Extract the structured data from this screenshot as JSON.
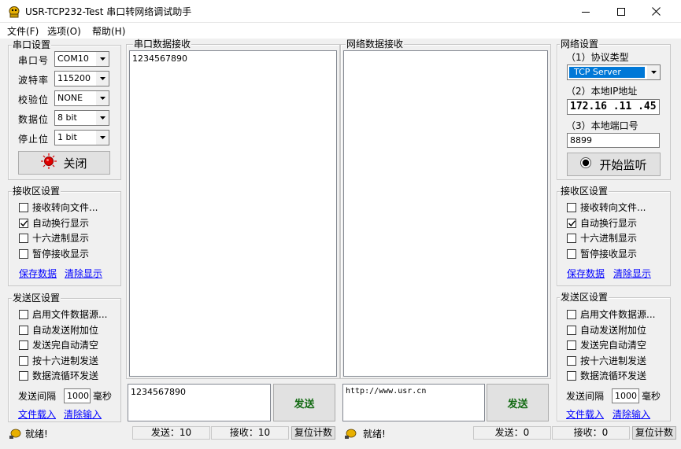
{
  "window": {
    "title": "USR-TCP232-Test 串口转网络调试助手"
  },
  "menu": [
    "文件(F)",
    "选项(O)",
    "帮助(H)"
  ],
  "serial_settings": {
    "legend": "串口设置",
    "port_label": "串口号",
    "port_value": "COM10",
    "baud_label": "波特率",
    "baud_value": "115200",
    "parity_label": "校验位",
    "parity_value": "NONE",
    "databits_label": "数据位",
    "databits_value": "8 bit",
    "stopbits_label": "停止位",
    "stopbits_value": "1 bit",
    "close_button": "关闭"
  },
  "left_recv_settings": {
    "legend": "接收区设置",
    "options": [
      {
        "label": "接收转向文件...",
        "checked": false
      },
      {
        "label": "自动换行显示",
        "checked": true
      },
      {
        "label": "十六进制显示",
        "checked": false
      },
      {
        "label": "暂停接收显示",
        "checked": false
      }
    ],
    "save_link": "保存数据",
    "clear_link": "清除显示"
  },
  "left_send_settings": {
    "legend": "发送区设置",
    "options": [
      {
        "label": "启用文件数据源...",
        "checked": false
      },
      {
        "label": "自动发送附加位",
        "checked": false
      },
      {
        "label": "发送完自动清空",
        "checked": false
      },
      {
        "label": "按十六进制发送",
        "checked": false
      },
      {
        "label": "数据流循环发送",
        "checked": false
      }
    ],
    "interval_label": "发送间隔",
    "interval_value": "1000",
    "interval_unit": "毫秒",
    "load_link": "文件载入",
    "clear_link": "清除输入"
  },
  "serial_recv": {
    "legend": "串口数据接收",
    "content": "1234567890"
  },
  "net_recv": {
    "legend": "网络数据接收",
    "content": ""
  },
  "serial_send": {
    "content": "1234567890",
    "send_button": "发送"
  },
  "net_send": {
    "content": "http://www.usr.cn",
    "send_button": "发送"
  },
  "net_settings": {
    "legend": "网络设置",
    "protocol_label": "（1）协议类型",
    "protocol_value": "TCP Server",
    "ip_label": "（2）本地IP地址",
    "ip_value": "172.16 .11 .45",
    "port_label": "（3）本地端口号",
    "port_value": "8899",
    "listen_button": "开始监听"
  },
  "right_recv_settings": {
    "legend": "接收区设置",
    "options": [
      {
        "label": "接收转向文件...",
        "checked": false
      },
      {
        "label": "自动换行显示",
        "checked": true
      },
      {
        "label": "十六进制显示",
        "checked": false
      },
      {
        "label": "暂停接收显示",
        "checked": false
      }
    ],
    "save_link": "保存数据",
    "clear_link": "清除显示"
  },
  "right_send_settings": {
    "legend": "发送区设置",
    "options": [
      {
        "label": "启用文件数据源...",
        "checked": false
      },
      {
        "label": "自动发送附加位",
        "checked": false
      },
      {
        "label": "发送完自动清空",
        "checked": false
      },
      {
        "label": "按十六进制发送",
        "checked": false
      },
      {
        "label": "数据流循环发送",
        "checked": false
      }
    ],
    "interval_label": "发送间隔",
    "interval_value": "1000",
    "interval_unit": "毫秒",
    "load_link": "文件载入",
    "clear_link": "清除输入"
  },
  "status_left": {
    "ready": "就绪!",
    "sent": "发送：10",
    "received": "接收：10",
    "reset": "复位计数"
  },
  "status_right": {
    "ready": "就绪!",
    "sent": "发送：0",
    "received": "接收：0",
    "reset": "复位计数"
  },
  "colors": {
    "accent": "#0078d7",
    "send_text": "#136b13",
    "link": "#0000ff"
  }
}
